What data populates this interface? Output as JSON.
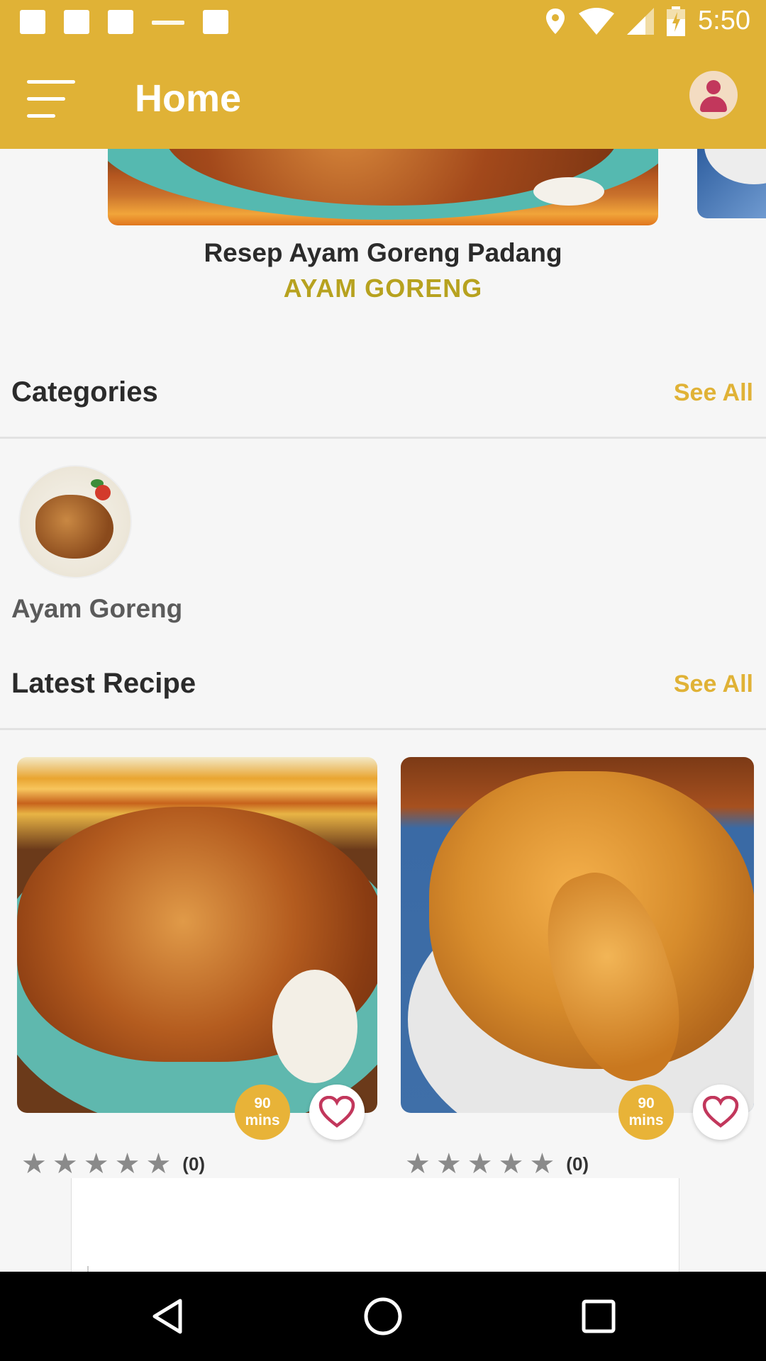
{
  "status_bar": {
    "time": "5:50",
    "icons": [
      "notification-square-icon",
      "notification-square-icon",
      "notification-square-icon",
      "notification-tiny-text-icon",
      "notification-square-icon",
      "location-icon",
      "wifi-icon",
      "signal-icon",
      "battery-icon"
    ]
  },
  "app_bar": {
    "title": "Home",
    "menu_icon": "menu-icon",
    "profile_icon": "profile-avatar-icon",
    "color": "#e0b236"
  },
  "hero": {
    "title": "Resep Ayam Goreng Padang",
    "category": "AYAM GORENG"
  },
  "categories": {
    "title": "Categories",
    "see_all": "See All",
    "items": [
      {
        "label": "Ayam Goreng"
      }
    ]
  },
  "latest": {
    "title": "Latest Recipe",
    "see_all": "See All",
    "cards": [
      {
        "time_value": "90",
        "time_unit": "mins",
        "rating_count": "(0)",
        "stars": 5,
        "rating": 0
      },
      {
        "time_value": "90",
        "time_unit": "mins",
        "rating_count": "(0)",
        "stars": 5,
        "rating": 0
      }
    ]
  },
  "nav_bar": {
    "buttons": [
      "back-icon",
      "home-circle-icon",
      "recents-square-icon"
    ]
  },
  "colors": {
    "accent": "#e0b236",
    "category_text": "#b7a21f",
    "heart": "#c2375c"
  }
}
